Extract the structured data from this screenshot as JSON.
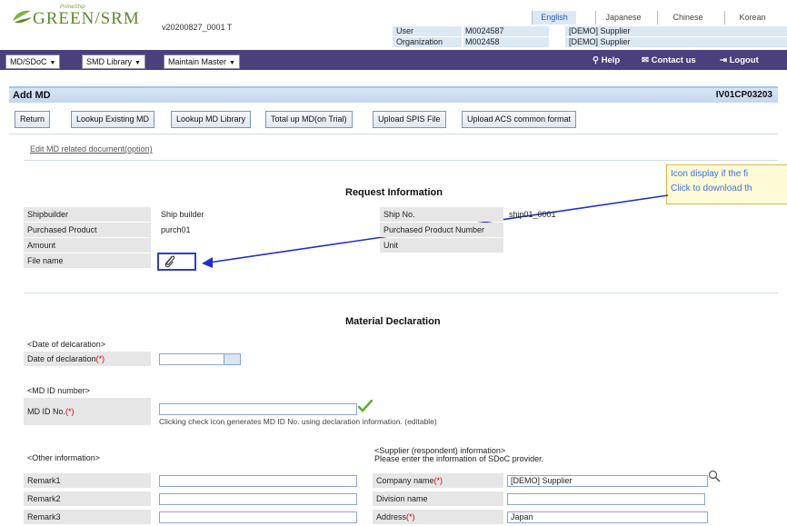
{
  "header": {
    "logo_small": "PrimeShip",
    "logo_main": "GREEN/SRM",
    "version": "v20200827_0001 T",
    "languages": [
      "English",
      "Japanese",
      "Chinese",
      "Korean"
    ],
    "user_label": "User",
    "user_id": "M0024587",
    "user_name": "[DEMO] Supplier",
    "org_label": "Organization",
    "org_id": "M002458",
    "org_name": "[DEMO] Supplier"
  },
  "menu": {
    "items": [
      "MD/SDoC",
      "SMD Library",
      "Maintain Master"
    ],
    "help": "Help",
    "contact": "Contact us",
    "logout": "Logout"
  },
  "page": {
    "title": "Add MD",
    "screen_id": "IV01CP03203"
  },
  "actions": [
    "Return",
    "Lookup Existing MD",
    "Lookup MD Library",
    "Total up MD(on Trial)",
    "Upload SPIS File",
    "Upload ACS common format"
  ],
  "edit_link": "Edit MD related document(option)",
  "callout": {
    "line1": "Icon display if the fi",
    "line2": "Click to download th"
  },
  "request": {
    "title": "Request Information",
    "shipbuilder_label": "Shipbuilder",
    "shipbuilder": "Ship builder",
    "ship_no_label": "Ship No.",
    "ship_no": "ship01_0001",
    "product_label": "Purchased Product",
    "product": "purch01",
    "product_no_label": "Purchased Product Number",
    "product_no": "",
    "amount_label": "Amount",
    "unit_label": "Unit",
    "file_label": "File name"
  },
  "material": {
    "title": "Material Declaration",
    "date_section": "<Date of delcaration>",
    "date_label": "Date of declaration",
    "req_mark": "(*)",
    "id_section": "<MD ID number>",
    "id_label": "MD ID No.",
    "id_note": "Clicking check icon generates MD ID No. using declaration information. (editable)",
    "other_section": "<Other information>",
    "supplier_section": "<Supplier (respondent) information>",
    "supplier_note": "Please enter the information of SDoC provider.",
    "remark1": "Remark1",
    "remark2": "Remark2",
    "remark3": "Remark3",
    "company_label": "Company name",
    "company_value": "[DEMO] Supplier",
    "division_label": "Division name",
    "address_label": "Address",
    "address_value": "Japan"
  },
  "colors": {
    "menubar": "#4b3f7d",
    "accent": "#2f5e9c",
    "required": "#d00000"
  }
}
